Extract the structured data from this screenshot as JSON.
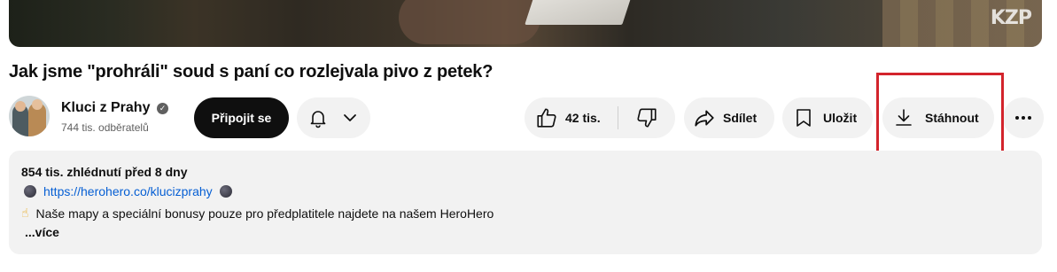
{
  "video": {
    "watermark": "KZP"
  },
  "title": "Jak jsme \"prohráli\" soud s paní co rozlejvala pivo z petek?",
  "channel": {
    "name": "Kluci z Prahy",
    "subscribers": "744 tis. odběratelů",
    "verified_glyph": "✓"
  },
  "buttons": {
    "join": "Připojit se",
    "likes": "42 tis.",
    "share": "Sdílet",
    "save": "Uložit",
    "download": "Stáhnout"
  },
  "description": {
    "meta": "854 tis. zhlédnutí  před 8 dny",
    "link": "https://herohero.co/klucizprahy",
    "emoji": "☝",
    "text": "Naše mapy a speciální bonusy pouze pro předplatitele najdete na našem HeroHero",
    "more": "...více"
  },
  "icons": [
    "bell-icon",
    "chevron-down-icon",
    "thumbs-up-icon",
    "thumbs-down-icon",
    "share-icon",
    "bookmark-icon",
    "download-icon",
    "more-icon"
  ],
  "colors": {
    "highlight": "#d3242c",
    "link": "#065fd4",
    "pill": "#f2f2f2"
  }
}
